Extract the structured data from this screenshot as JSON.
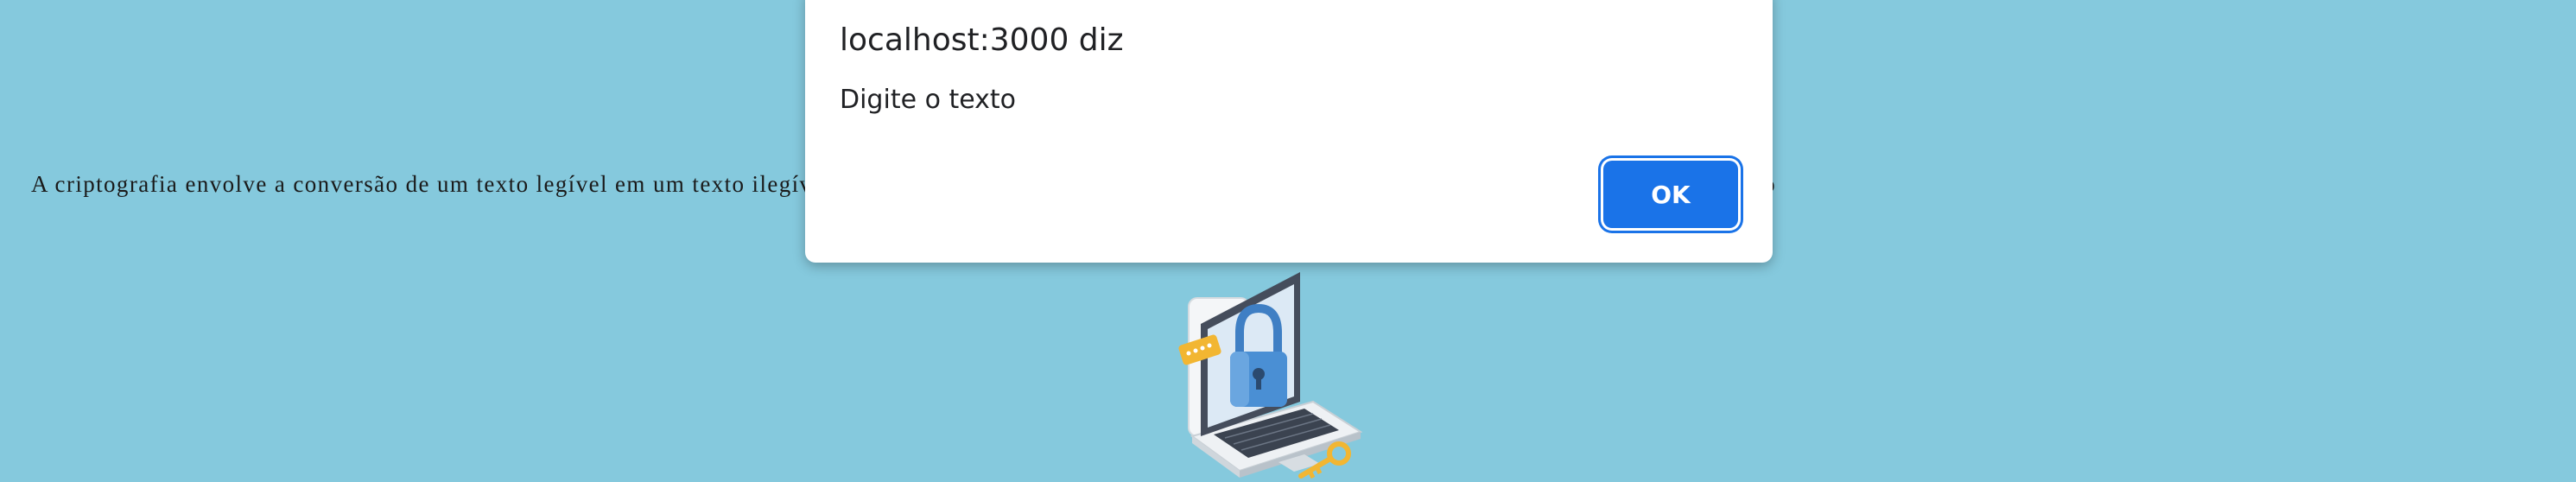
{
  "content": {
    "paragraph": "A criptografia envolve a conversão de um texto legível em um texto ilegível, utilizada para proporcionar uma camada extra de proteção a informações privadas, como"
  },
  "illustration": {
    "icon": "laptop-padlock-key-illustration",
    "colors": {
      "padlock": "#4a8fd4",
      "key": "#f2b632",
      "laptop": "#e8ecef"
    }
  },
  "dialog": {
    "title": "localhost:3000 diz",
    "message": "Digite o texto",
    "ok_label": "OK"
  },
  "colors": {
    "background": "#85c9dd",
    "accent": "#1a73e8"
  }
}
